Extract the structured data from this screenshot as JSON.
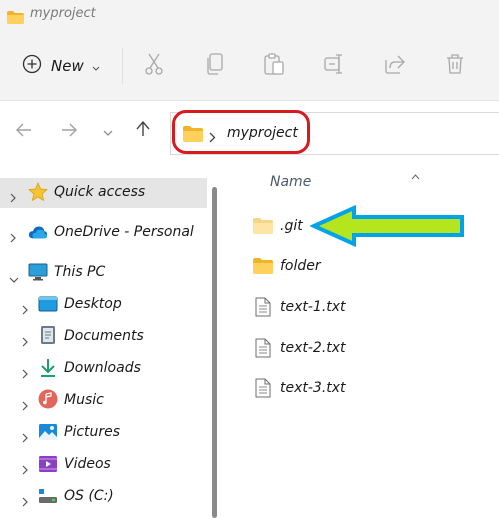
{
  "window": {
    "title": "myproject"
  },
  "toolbar": {
    "new_label": "New",
    "actions": [
      "cut-icon",
      "copy-icon",
      "paste-icon",
      "rename-icon",
      "share-icon",
      "delete-icon"
    ]
  },
  "address": {
    "path": [
      "myproject"
    ]
  },
  "sidebar": {
    "items": [
      {
        "label": "Quick access",
        "icon": "star-icon"
      },
      {
        "label": "OneDrive - Personal",
        "icon": "cloud-icon"
      },
      {
        "label": "This PC",
        "icon": "monitor-icon"
      },
      {
        "label": "Desktop",
        "icon": "desktop-icon"
      },
      {
        "label": "Documents",
        "icon": "documents-icon"
      },
      {
        "label": "Downloads",
        "icon": "download-icon"
      },
      {
        "label": "Music",
        "icon": "music-icon"
      },
      {
        "label": "Pictures",
        "icon": "pictures-icon"
      },
      {
        "label": "Videos",
        "icon": "videos-icon"
      },
      {
        "label": "OS (C:)",
        "icon": "drive-icon"
      }
    ]
  },
  "main": {
    "column_header": "Name",
    "files": [
      {
        "name": ".git",
        "type": "folder"
      },
      {
        "name": "folder",
        "type": "folder"
      },
      {
        "name": "text-1.txt",
        "type": "file"
      },
      {
        "name": "text-2.txt",
        "type": "file"
      },
      {
        "name": "text-3.txt",
        "type": "file"
      }
    ]
  },
  "colors": {
    "highlight_oval": "#d8191e",
    "arrow_fill": "#b5e61d",
    "arrow_stroke": "#00a2e8",
    "folder": "#f8c74b"
  }
}
